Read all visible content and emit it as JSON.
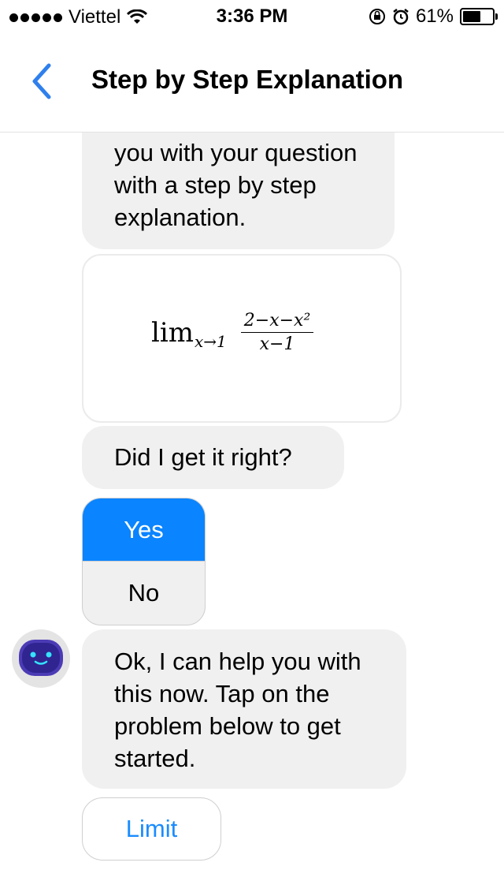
{
  "status_bar": {
    "carrier": "Viettel",
    "time": "3:36 PM",
    "battery": "61%",
    "battery_level": 0.61,
    "signal_bars": 5
  },
  "nav": {
    "title": "Step by Step Explanation"
  },
  "chat": {
    "intro_text": "you with your question with a step by step explanation.",
    "math": {
      "lim": "lim",
      "subscript": "x→1",
      "numerator": "2−x−x²",
      "denominator": "x−1"
    },
    "question": "Did I get it right?",
    "choices": {
      "yes": "Yes",
      "no": "No"
    },
    "help_text": "Ok, I can help you with this now. Tap on the problem below to get started.",
    "limit_button": "Limit"
  },
  "colors": {
    "accent": "#0a84ff",
    "back_arrow": "#2f80ed",
    "bubble_bg": "#f0f0f0",
    "link_text": "#1a8cff",
    "avatar_face": "#3b2a9e"
  },
  "icons": {
    "back": "chevron-left-icon",
    "wifi": "wifi-icon",
    "alarm": "alarm-icon",
    "rotation_lock": "rotation-lock-icon",
    "battery": "battery-icon",
    "bot": "robot-avatar-icon"
  }
}
